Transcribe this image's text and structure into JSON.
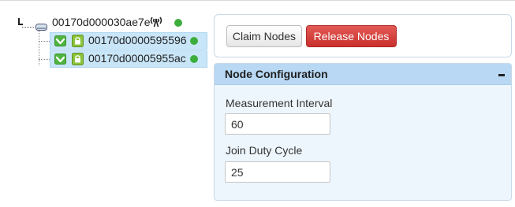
{
  "tree": {
    "root": {
      "label": "00170d000030ae7e",
      "status_color": "#3cae3c",
      "icon": "device-icon",
      "signal_icon": "antenna-icon"
    },
    "children": [
      {
        "label": "00170d0000595596",
        "status_color": "#3cae3c",
        "checked": true,
        "locked": true
      },
      {
        "label": "00170d00005955ac",
        "status_color": "#3cae3c",
        "checked": true,
        "locked": true
      }
    ]
  },
  "actions": {
    "claim_label": "Claim Nodes",
    "release_label": "Release Nodes"
  },
  "config": {
    "title": "Node Configuration",
    "collapse_icon": "minus-icon",
    "measurement_interval_label": "Measurement Interval",
    "measurement_interval_value": "60",
    "join_duty_cycle_label": "Join Duty Cycle",
    "join_duty_cycle_value": "25"
  },
  "colors": {
    "release_button": "#d9534f",
    "selected_row": "#c9e6f8",
    "config_header": "#b8d8f3",
    "status_online": "#3cae3c"
  }
}
